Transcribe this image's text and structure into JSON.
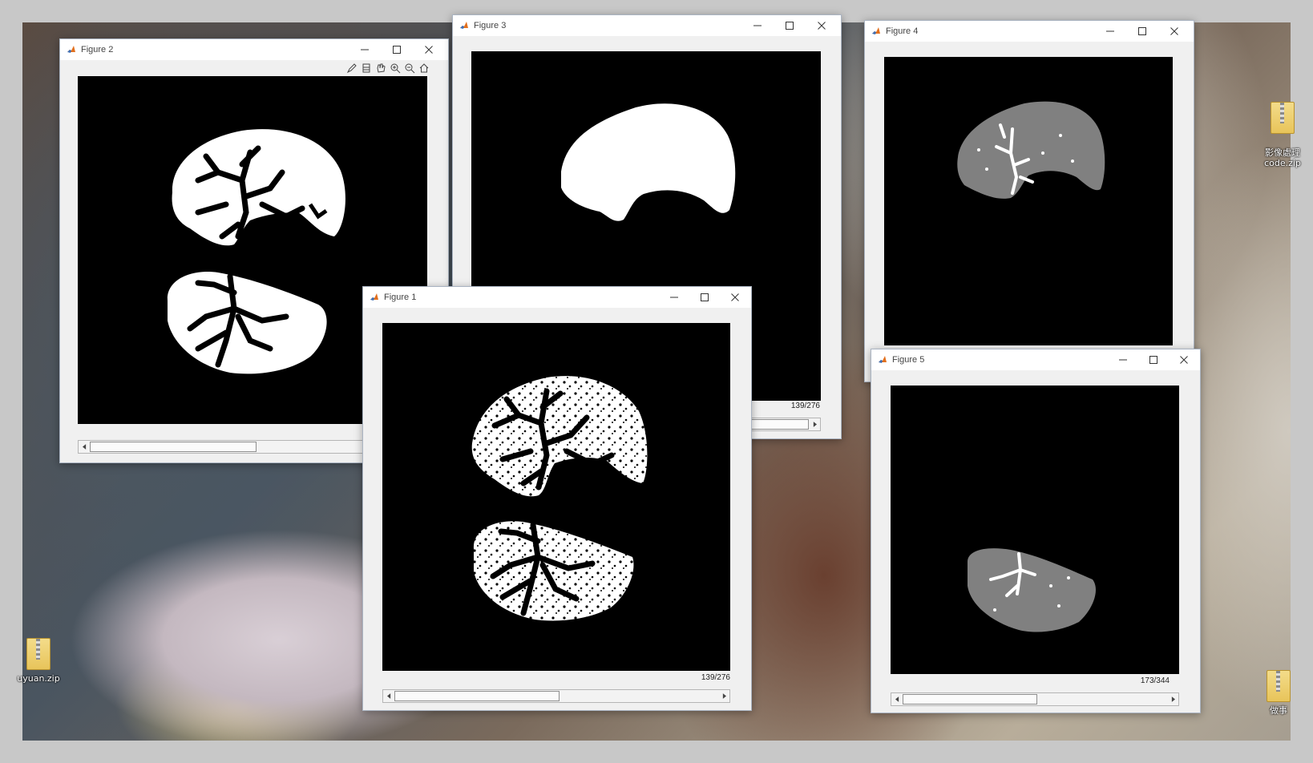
{
  "desktop": {
    "icons": [
      {
        "label": "uyuan.zip"
      },
      {
        "label": "影像處理\ncode.zip"
      },
      {
        "label": "做事"
      }
    ]
  },
  "windows": {
    "figure2": {
      "title": "Figure 2",
      "toolbar_icons": [
        "edit-plot-icon",
        "insert-colorbar-icon",
        "pan-hand-icon",
        "zoom-in-icon",
        "zoom-out-icon",
        "home-icon"
      ]
    },
    "figure3": {
      "title": "Figure 3",
      "slice_readout": "139/276"
    },
    "figure4": {
      "title": "Figure 4"
    },
    "figure5": {
      "title": "Figure 5",
      "slice_readout": "173/344"
    },
    "figure1": {
      "title": "Figure 1",
      "slice_readout": "139/276"
    }
  },
  "colors": {
    "image_background": "#000000",
    "mask_white": "#ffffff",
    "mask_gray": "#808080",
    "window_frame": "#f0f0f0",
    "titlebar": "#ffffff"
  },
  "sliders": {
    "figure2_value": 0.5,
    "figure3_value": 0.5,
    "figure1_value": 0.5,
    "figure5_value": 0.5
  }
}
